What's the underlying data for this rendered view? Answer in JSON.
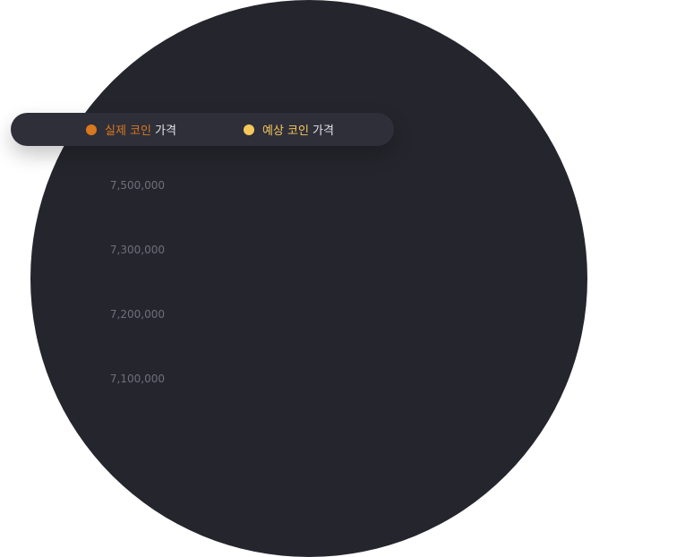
{
  "colors": {
    "background_circle": "#25252d",
    "legend_background": "#2f2f39",
    "actual": "#d9781e",
    "predicted": "#f5c85a",
    "gridline": "#000000",
    "tick_label": "#6f6f7a"
  },
  "legend": {
    "actual": {
      "accent": "실제 코인",
      "rest": "가격"
    },
    "predicted": {
      "accent": "예상 코인",
      "rest": "가격"
    }
  },
  "chart_data": {
    "type": "line",
    "title": "",
    "xlabel": "",
    "ylabel": "",
    "y_ticks": [
      "7,500,000",
      "7,300,000",
      "7,200,000",
      "7,100,000"
    ],
    "grid": true,
    "legend_position": "top-left",
    "series": [
      {
        "name": "실제 코인 가격",
        "color": "#d9781e",
        "values": []
      },
      {
        "name": "예상 코인 가격",
        "color": "#f5c85a",
        "values": []
      }
    ]
  }
}
